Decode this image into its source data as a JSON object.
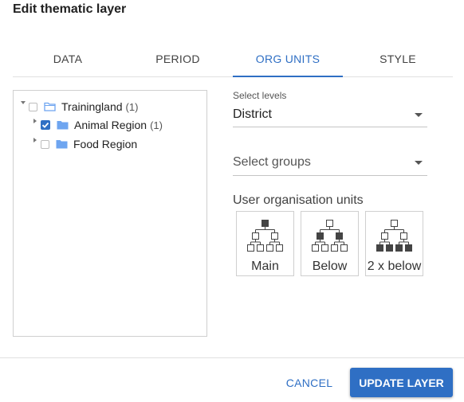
{
  "dialog": {
    "title": "Edit thematic layer"
  },
  "tabs": [
    {
      "label": "DATA",
      "active": false
    },
    {
      "label": "PERIOD",
      "active": false
    },
    {
      "label": "ORG UNITS",
      "active": true
    },
    {
      "label": "STYLE",
      "active": false
    }
  ],
  "tree": {
    "root": {
      "label": "Trainingland",
      "count": "(1)",
      "checked": false,
      "expanded": true,
      "icon": "folder-open-icon"
    },
    "children": [
      {
        "label": "Animal Region",
        "count": "(1)",
        "checked": true,
        "expanded": false,
        "icon": "folder-icon"
      },
      {
        "label": "Food Region",
        "count": "",
        "checked": false,
        "expanded": false,
        "icon": "folder-icon"
      }
    ]
  },
  "levels": {
    "label": "Select levels",
    "value": "District"
  },
  "groups": {
    "placeholder": "Select groups"
  },
  "user_org_units": {
    "title": "User organisation units",
    "options": [
      {
        "label": "Main",
        "icon": "hierarchy-main-icon"
      },
      {
        "label": "Below",
        "icon": "hierarchy-below-icon"
      },
      {
        "label": "2 x below",
        "icon": "hierarchy-two-below-icon"
      }
    ]
  },
  "footer": {
    "cancel_label": "CANCEL",
    "update_label": "UPDATE LAYER"
  },
  "colors": {
    "accent": "#2f6fc4",
    "folder": "#6ea5f0"
  }
}
